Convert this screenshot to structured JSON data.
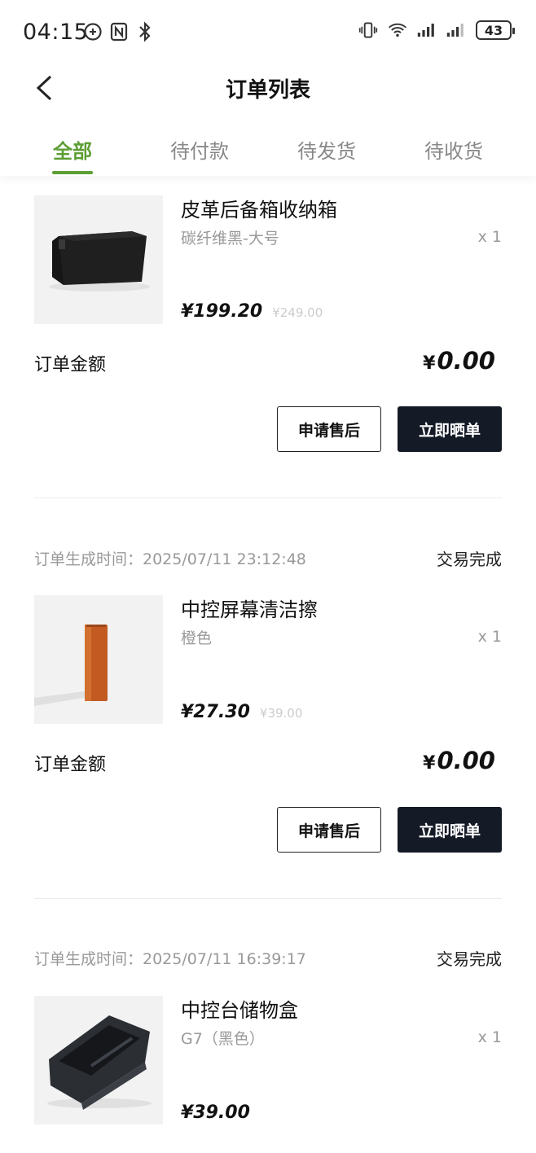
{
  "status_bar": {
    "time": "04:15",
    "battery": "43"
  },
  "nav": {
    "title": "订单列表"
  },
  "tabs": [
    {
      "label": "全部",
      "active": true
    },
    {
      "label": "待付款",
      "active": false
    },
    {
      "label": "待发货",
      "active": false
    },
    {
      "label": "待收货",
      "active": false
    }
  ],
  "orders": [
    {
      "product_name": "皮革后备箱收纳箱",
      "spec": "碳纤维黑-大号",
      "qty": "x 1",
      "price": "¥199.20",
      "original_price": "¥249.00",
      "total_label": "订单金额",
      "total_currency": "¥",
      "total_value": "0.00",
      "btn_after_sale": "申请售后",
      "btn_review": "立即晒单"
    },
    {
      "time_label": "订单生成时间：2025/07/11 23:12:48",
      "status": "交易完成",
      "product_name": "中控屏幕清洁擦",
      "spec": "橙色",
      "qty": "x 1",
      "price": "¥27.30",
      "original_price": "¥39.00",
      "total_label": "订单金额",
      "total_currency": "¥",
      "total_value": "0.00",
      "btn_after_sale": "申请售后",
      "btn_review": "立即晒单"
    },
    {
      "time_label": "订单生成时间：2025/07/11 16:39:17",
      "status": "交易完成",
      "product_name": "中控台储物盒",
      "spec": "G7（黑色）",
      "qty": "x 1",
      "price": "¥39.00"
    }
  ],
  "colors": {
    "accent": "#5d9e34",
    "dark_button": "#141a26"
  },
  "icons": [
    "nfc-icon",
    "bluetooth-icon",
    "vibrate-icon",
    "wifi-icon",
    "signal-icon",
    "back-arrow-icon"
  ]
}
